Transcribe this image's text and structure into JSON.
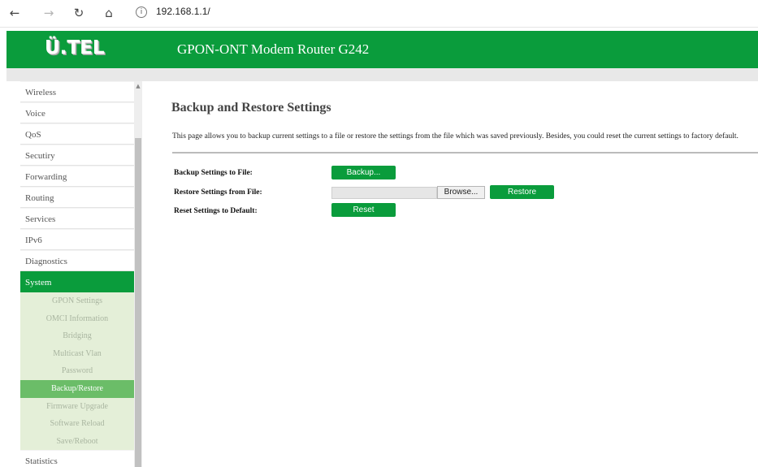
{
  "browser": {
    "back_icon": "←",
    "forward_icon": "→",
    "refresh_icon": "↻",
    "home_icon": "⌂",
    "info_icon": "i",
    "url": "192.168.1.1/"
  },
  "header": {
    "logo_text": "Ü.TEL",
    "title": "GPON-ONT Modem Router G242",
    "color": "#0a9c3c"
  },
  "sidebar": {
    "items": [
      {
        "label": "Wireless"
      },
      {
        "label": "Voice"
      },
      {
        "label": "QoS"
      },
      {
        "label": "Secutiry"
      },
      {
        "label": "Forwarding"
      },
      {
        "label": "Routing"
      },
      {
        "label": "Services"
      },
      {
        "label": "IPv6"
      },
      {
        "label": "Diagnostics"
      },
      {
        "label": "System",
        "active": true
      }
    ],
    "submenu": [
      {
        "label": "GPON Settings"
      },
      {
        "label": "OMCI Information"
      },
      {
        "label": "Bridging"
      },
      {
        "label": "Multicast Vlan"
      },
      {
        "label": "Password"
      },
      {
        "label": "Backup/Restore",
        "active": true
      },
      {
        "label": "Firmware Upgrade"
      },
      {
        "label": "Software Reload"
      },
      {
        "label": "Save/Reboot"
      }
    ],
    "bottom_item": "Statistics"
  },
  "main": {
    "title": "Backup and Restore Settings",
    "description": "This page allows you to backup current settings to a file or restore the settings from the file which was saved previously. Besides, you could reset the current settings to factory default.",
    "backup_label": "Backup Settings to File:",
    "backup_button": "Backup...",
    "restore_label": "Restore Settings from File:",
    "file_value": "",
    "browse_button": "Browse...",
    "restore_button": "Restore",
    "reset_label": "Reset Settings to Default:",
    "reset_button": "Reset"
  }
}
